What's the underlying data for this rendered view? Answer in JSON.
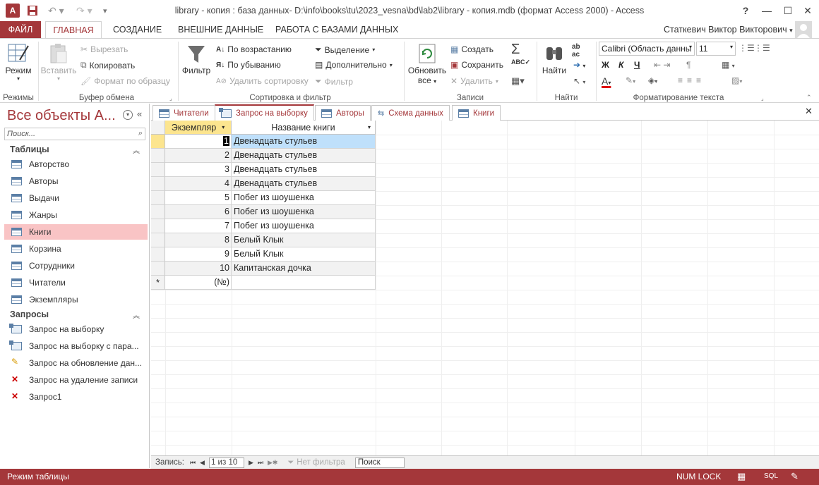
{
  "window": {
    "title": "library - копия : база данных- D:\\info\\books\\tu\\2023_vesna\\bd\\lab2\\library - копия.mdb (формат Access 2000) - Access",
    "help": "?",
    "app_letter": "A"
  },
  "menu": {
    "file": "ФАЙЛ",
    "tabs": [
      "ГЛАВНАЯ",
      "СОЗДАНИЕ",
      "ВНЕШНИЕ ДАННЫЕ",
      "РАБОТА С БАЗАМИ ДАННЫХ"
    ],
    "user": "Статкевич Виктор Викторович"
  },
  "ribbon": {
    "views": {
      "mode": "Режим",
      "group": "Режимы"
    },
    "clipboard": {
      "paste": "Вставить",
      "cut": "Вырезать",
      "copy": "Копировать",
      "format_painter": "Формат по образцу",
      "group": "Буфер обмена"
    },
    "sort": {
      "filter": "Фильтр",
      "asc": "По возрастанию",
      "desc": "По убыванию",
      "remove": "Удалить сортировку",
      "selection": "Выделение",
      "advanced": "Дополнительно",
      "toggle": "Фильтр",
      "group": "Сортировка и фильтр"
    },
    "records": {
      "refresh": "Обновить",
      "refresh2": "все",
      "create": "Создать",
      "save": "Сохранить",
      "delete": "Удалить",
      "group": "Записи"
    },
    "find": {
      "find": "Найти",
      "group": "Найти"
    },
    "text": {
      "font": "Calibri (Область данны",
      "size": "11",
      "bold": "Ж",
      "italic": "К",
      "underline": "Ч",
      "group": "Форматирование текста"
    }
  },
  "nav": {
    "title": "Все объекты А...",
    "search_placeholder": "Поиск...",
    "sections": [
      {
        "title": "Таблицы",
        "items": [
          "Авторство",
          "Авторы",
          "Выдачи",
          "Жанры",
          "Книги",
          "Корзина",
          "Сотрудники",
          "Читатели",
          "Экземпляры"
        ]
      },
      {
        "title": "Запросы",
        "items": [
          "Запрос на выборку",
          "Запрос на выборку с пара...",
          "Запрос на обновление дан...",
          "Запрос на удаление записи",
          "Запрос1"
        ]
      }
    ],
    "selected": "Книги"
  },
  "doc_tabs": [
    "Читатели",
    "Запрос на выборку",
    "Авторы",
    "Схема данных",
    "Книги"
  ],
  "active_tab": "Запрос на выборку",
  "table": {
    "columns": [
      "Экземпляр",
      "Название книги"
    ],
    "rows": [
      [
        "1",
        "Двенадцать стульев"
      ],
      [
        "2",
        "Двенадцать стульев"
      ],
      [
        "3",
        "Двенадцать стульев"
      ],
      [
        "4",
        "Двенадцать стульев"
      ],
      [
        "5",
        "Побег из шоушенка"
      ],
      [
        "6",
        "Побег из шоушенка"
      ],
      [
        "7",
        "Побег из шоушенка"
      ],
      [
        "8",
        "Белый Клык"
      ],
      [
        "9",
        "Белый Клык"
      ],
      [
        "10",
        "Капитанская дочка"
      ]
    ],
    "new_row_marker": "*",
    "new_row_value": "(№)"
  },
  "record_nav": {
    "label": "Запись:",
    "position": "1 из 10",
    "filter": "Нет фильтра",
    "search": "Поиск"
  },
  "status": {
    "mode": "Режим таблицы",
    "numlock": "NUM LOCK",
    "sql": "SQL"
  },
  "colors": {
    "accent": "#a4373a",
    "selected_nav": "#f9c4c5",
    "selected_cell": "#bfe0fb",
    "header_active": "#fce58f"
  }
}
